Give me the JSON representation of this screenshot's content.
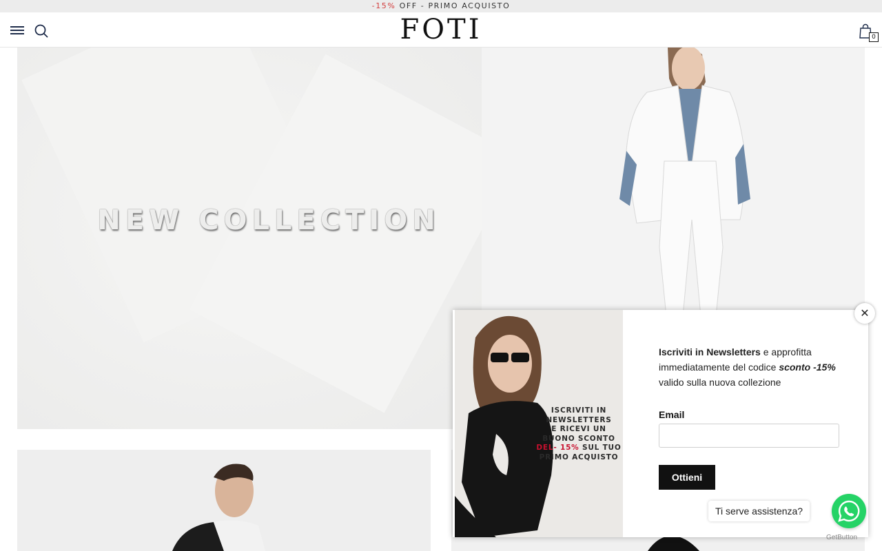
{
  "announcement": {
    "discount": "-15%",
    "rest": " OFF - PRIMO ACQUISTO"
  },
  "header": {
    "logo": "FOTI",
    "cart_count": "0"
  },
  "hero": {
    "title": "NEW COLLECTION"
  },
  "popup": {
    "image_text_lines": [
      "ISCRIVITI IN",
      "NEWSLETTERS",
      "E RICEVI UN",
      "BUONO SCONTO"
    ],
    "image_text_red": "DEL- 15%",
    "image_text_after": " SUL TUO",
    "image_text_last": "PRIMO ACQUISTO",
    "text_bold": "Iscriviti in Newsletters",
    "text_1": " e approfitta immediatamente del codice ",
    "text_code": "sconto -15%",
    "text_2": " valido sulla nuova collezione",
    "email_label": "Email",
    "email_placeholder": "",
    "submit_label": "Ottieni",
    "close_label": "✕"
  },
  "whatsapp": {
    "bubble": "Ti serve assistenza?",
    "credit": "GetButton"
  },
  "colors": {
    "accent_red": "#d23b3b",
    "whatsapp": "#25d366",
    "dark": "#111111"
  }
}
